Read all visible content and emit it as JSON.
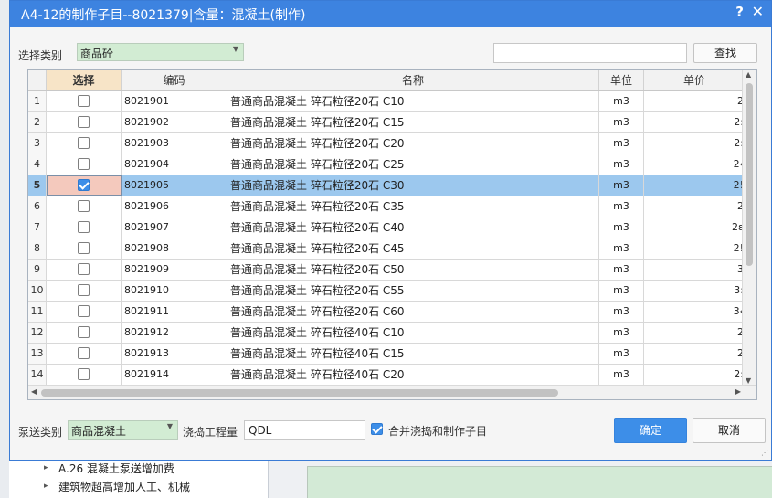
{
  "background": {
    "tree_items": [
      "A.26 混凝土泵送增加费",
      "建筑物超高增加人工、机械"
    ]
  },
  "dialog": {
    "title": "A4-12的制作子目--8021379|含量：混凝土(制作)",
    "help_label": "?",
    "close_label": "✕",
    "category_label": "选择类别",
    "category_value": "商品砼",
    "search_value": "",
    "search_button": "查找",
    "pump_label": "泵送类别",
    "pump_value": "商品混凝土",
    "qty_label": "浇捣工程量",
    "qty_value": "QDL",
    "merge_label": "合并浇捣和制作子目",
    "merge_checked": true,
    "ok_button": "确定",
    "cancel_button": "取消"
  },
  "grid": {
    "headers": {
      "select": "选择",
      "code": "编码",
      "name": "名称",
      "unit": "单位",
      "price": "单价"
    },
    "rows": [
      {
        "num": "1",
        "checked": false,
        "code": "8021901",
        "name": "普通商品混凝土 碎石粒径20石 C10",
        "unit": "m3",
        "price": "2"
      },
      {
        "num": "2",
        "checked": false,
        "code": "8021902",
        "name": "普通商品混凝土 碎石粒径20石 C15",
        "unit": "m3",
        "price": "2:"
      },
      {
        "num": "3",
        "checked": false,
        "code": "8021903",
        "name": "普通商品混凝土 碎石粒径20石 C20",
        "unit": "m3",
        "price": "2:"
      },
      {
        "num": "4",
        "checked": false,
        "code": "8021904",
        "name": "普通商品混凝土 碎石粒径20石 C25",
        "unit": "m3",
        "price": "2‹"
      },
      {
        "num": "5",
        "checked": true,
        "code": "8021905",
        "name": "普通商品混凝土 碎石粒径20石 C30",
        "unit": "m3",
        "price": "2!"
      },
      {
        "num": "6",
        "checked": false,
        "code": "8021906",
        "name": "普通商品混凝土 碎石粒径20石 C35",
        "unit": "m3",
        "price": "2"
      },
      {
        "num": "7",
        "checked": false,
        "code": "8021907",
        "name": "普通商品混凝土 碎石粒径20石 C40",
        "unit": "m3",
        "price": "2ɛ"
      },
      {
        "num": "8",
        "checked": false,
        "code": "8021908",
        "name": "普通商品混凝土 碎石粒径20石 C45",
        "unit": "m3",
        "price": "2!"
      },
      {
        "num": "9",
        "checked": false,
        "code": "8021909",
        "name": "普通商品混凝土 碎石粒径20石 C50",
        "unit": "m3",
        "price": "3"
      },
      {
        "num": "10",
        "checked": false,
        "code": "8021910",
        "name": "普通商品混凝土 碎石粒径20石 C55",
        "unit": "m3",
        "price": "3:"
      },
      {
        "num": "11",
        "checked": false,
        "code": "8021911",
        "name": "普通商品混凝土 碎石粒径20石 C60",
        "unit": "m3",
        "price": "3‹"
      },
      {
        "num": "12",
        "checked": false,
        "code": "8021912",
        "name": "普通商品混凝土 碎石粒径40石 C10",
        "unit": "m3",
        "price": "2"
      },
      {
        "num": "13",
        "checked": false,
        "code": "8021913",
        "name": "普通商品混凝土 碎石粒径40石 C15",
        "unit": "m3",
        "price": "2"
      },
      {
        "num": "14",
        "checked": false,
        "code": "8021914",
        "name": "普通商品混凝土 碎石粒径40石 C20",
        "unit": "m3",
        "price": "2:"
      }
    ],
    "selected_row": 4
  }
}
